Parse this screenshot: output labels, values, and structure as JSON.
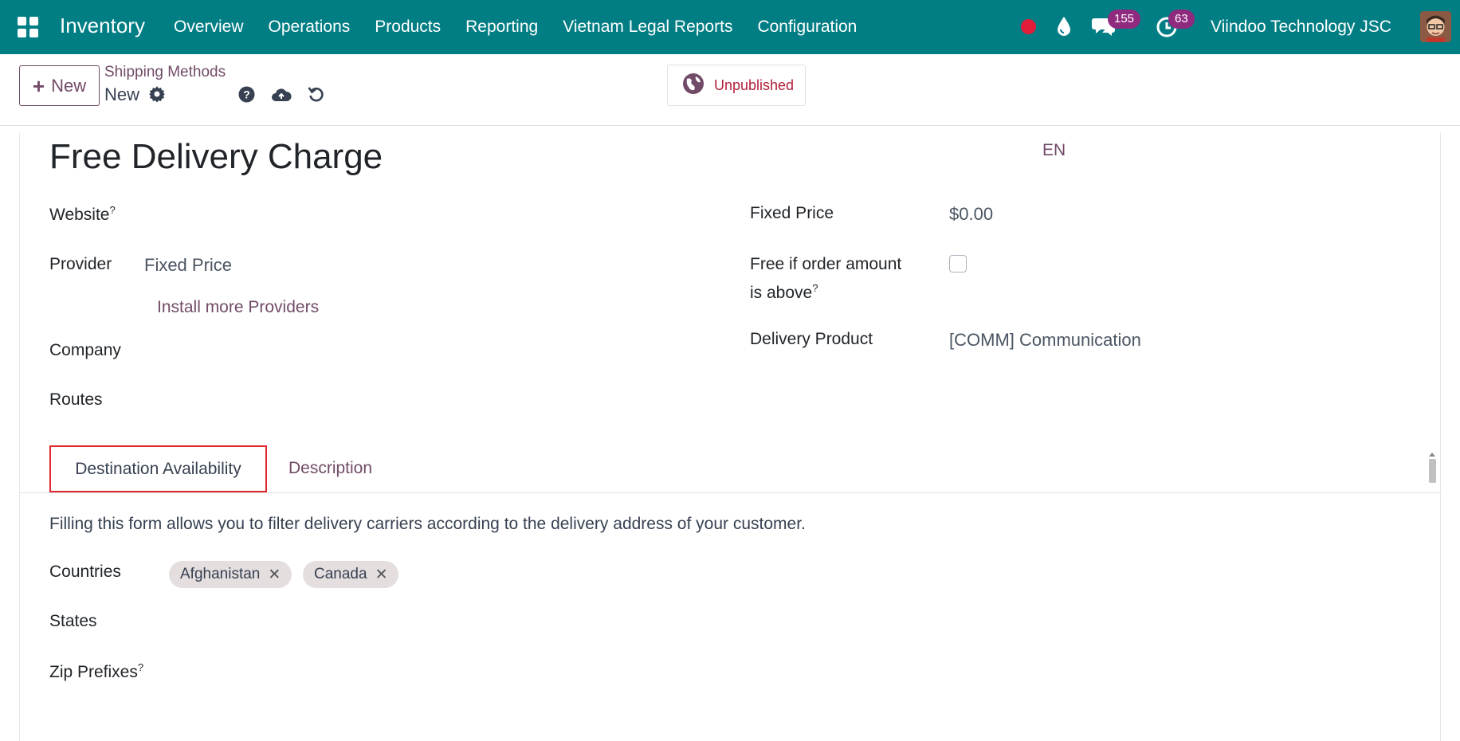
{
  "navbar": {
    "brand": "Inventory",
    "menu": [
      "Overview",
      "Operations",
      "Products",
      "Reporting",
      "Vietnam Legal Reports",
      "Configuration"
    ],
    "chat_count": "155",
    "activity_count": "63",
    "company": "Viindoo Technology JSC"
  },
  "control": {
    "new_label": "New",
    "breadcrumb": "Shipping Methods",
    "record_name": "New",
    "publish_label": "Unpublished"
  },
  "form": {
    "title": "Free Delivery Charge",
    "lang": "EN",
    "website_label": "Website",
    "provider_label": "Provider",
    "provider_value": "Fixed Price",
    "install_link": "Install more Providers",
    "company_label": "Company",
    "routes_label": "Routes",
    "fixed_price_label": "Fixed Price",
    "fixed_price_value": "$0.00",
    "free_if_label_1": "Free if order amount",
    "free_if_label_2": "is above",
    "delivery_product_label": "Delivery Product",
    "delivery_product_value": "[COMM] Communication",
    "tooltip_mark": "?"
  },
  "tabs": {
    "active": "Destination Availability",
    "other": "Description"
  },
  "destination": {
    "hint": "Filling this form allows you to filter delivery carriers according to the delivery address of your customer.",
    "countries_label": "Countries",
    "countries": [
      "Afghanistan",
      "Canada"
    ],
    "states_label": "States",
    "zip_label": "Zip Prefixes"
  },
  "colors": {
    "navbar": "#017e84",
    "brand_purple": "#714b67",
    "unpublished_red": "#b21f3a",
    "highlight_border": "#e0252c"
  }
}
